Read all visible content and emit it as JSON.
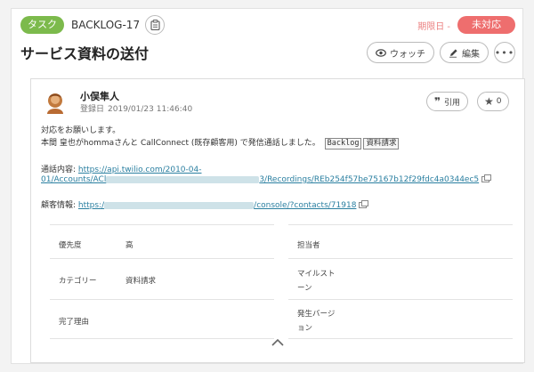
{
  "header": {
    "issue_type": "タスク",
    "issue_key": "BACKLOG-17",
    "due_label": "期限日 -",
    "status": "未対応"
  },
  "title": "サービス資料の送付",
  "actions": {
    "watch": "ウォッチ",
    "edit": "編集"
  },
  "comment": {
    "author": "小俣隼人",
    "created_label": "登録日",
    "created_at": "2019/01/23 11:46:40",
    "quote": "引用",
    "star_count": "0",
    "line1": "対応をお願いします。",
    "line2": "本間 皇也がhommaさんと CallConnect (既存顧客用) で発信通話しました。",
    "tag1": "Backlog",
    "tag2": "資料請求",
    "call_label": "通話内容:",
    "call_url_part1": "https://api.twilio.com/2010-04-",
    "call_url_part2a": "01/Accounts/ACl",
    "call_url_part2b": "3/Recordings/REb254f57be75167b12f29fdc4a0344ec5",
    "customer_label": "顧客情報:",
    "customer_url_a": "https:/",
    "customer_url_b": "/console/?contacts/71918"
  },
  "properties": {
    "priority_label": "優先度",
    "priority_value": "高",
    "assignee_label": "担当者",
    "category_label": "カテゴリー",
    "category_value": "資料請求",
    "milestone_label_1": "マイルスト",
    "milestone_label_2": "ーン",
    "resolution_label": "完了理由",
    "version_label_1": "発生バージ",
    "version_label_2": "ョン"
  },
  "colors": {
    "issue_type": "#7cba4c",
    "status": "#ee6e6e",
    "link": "#2a7fa0"
  }
}
